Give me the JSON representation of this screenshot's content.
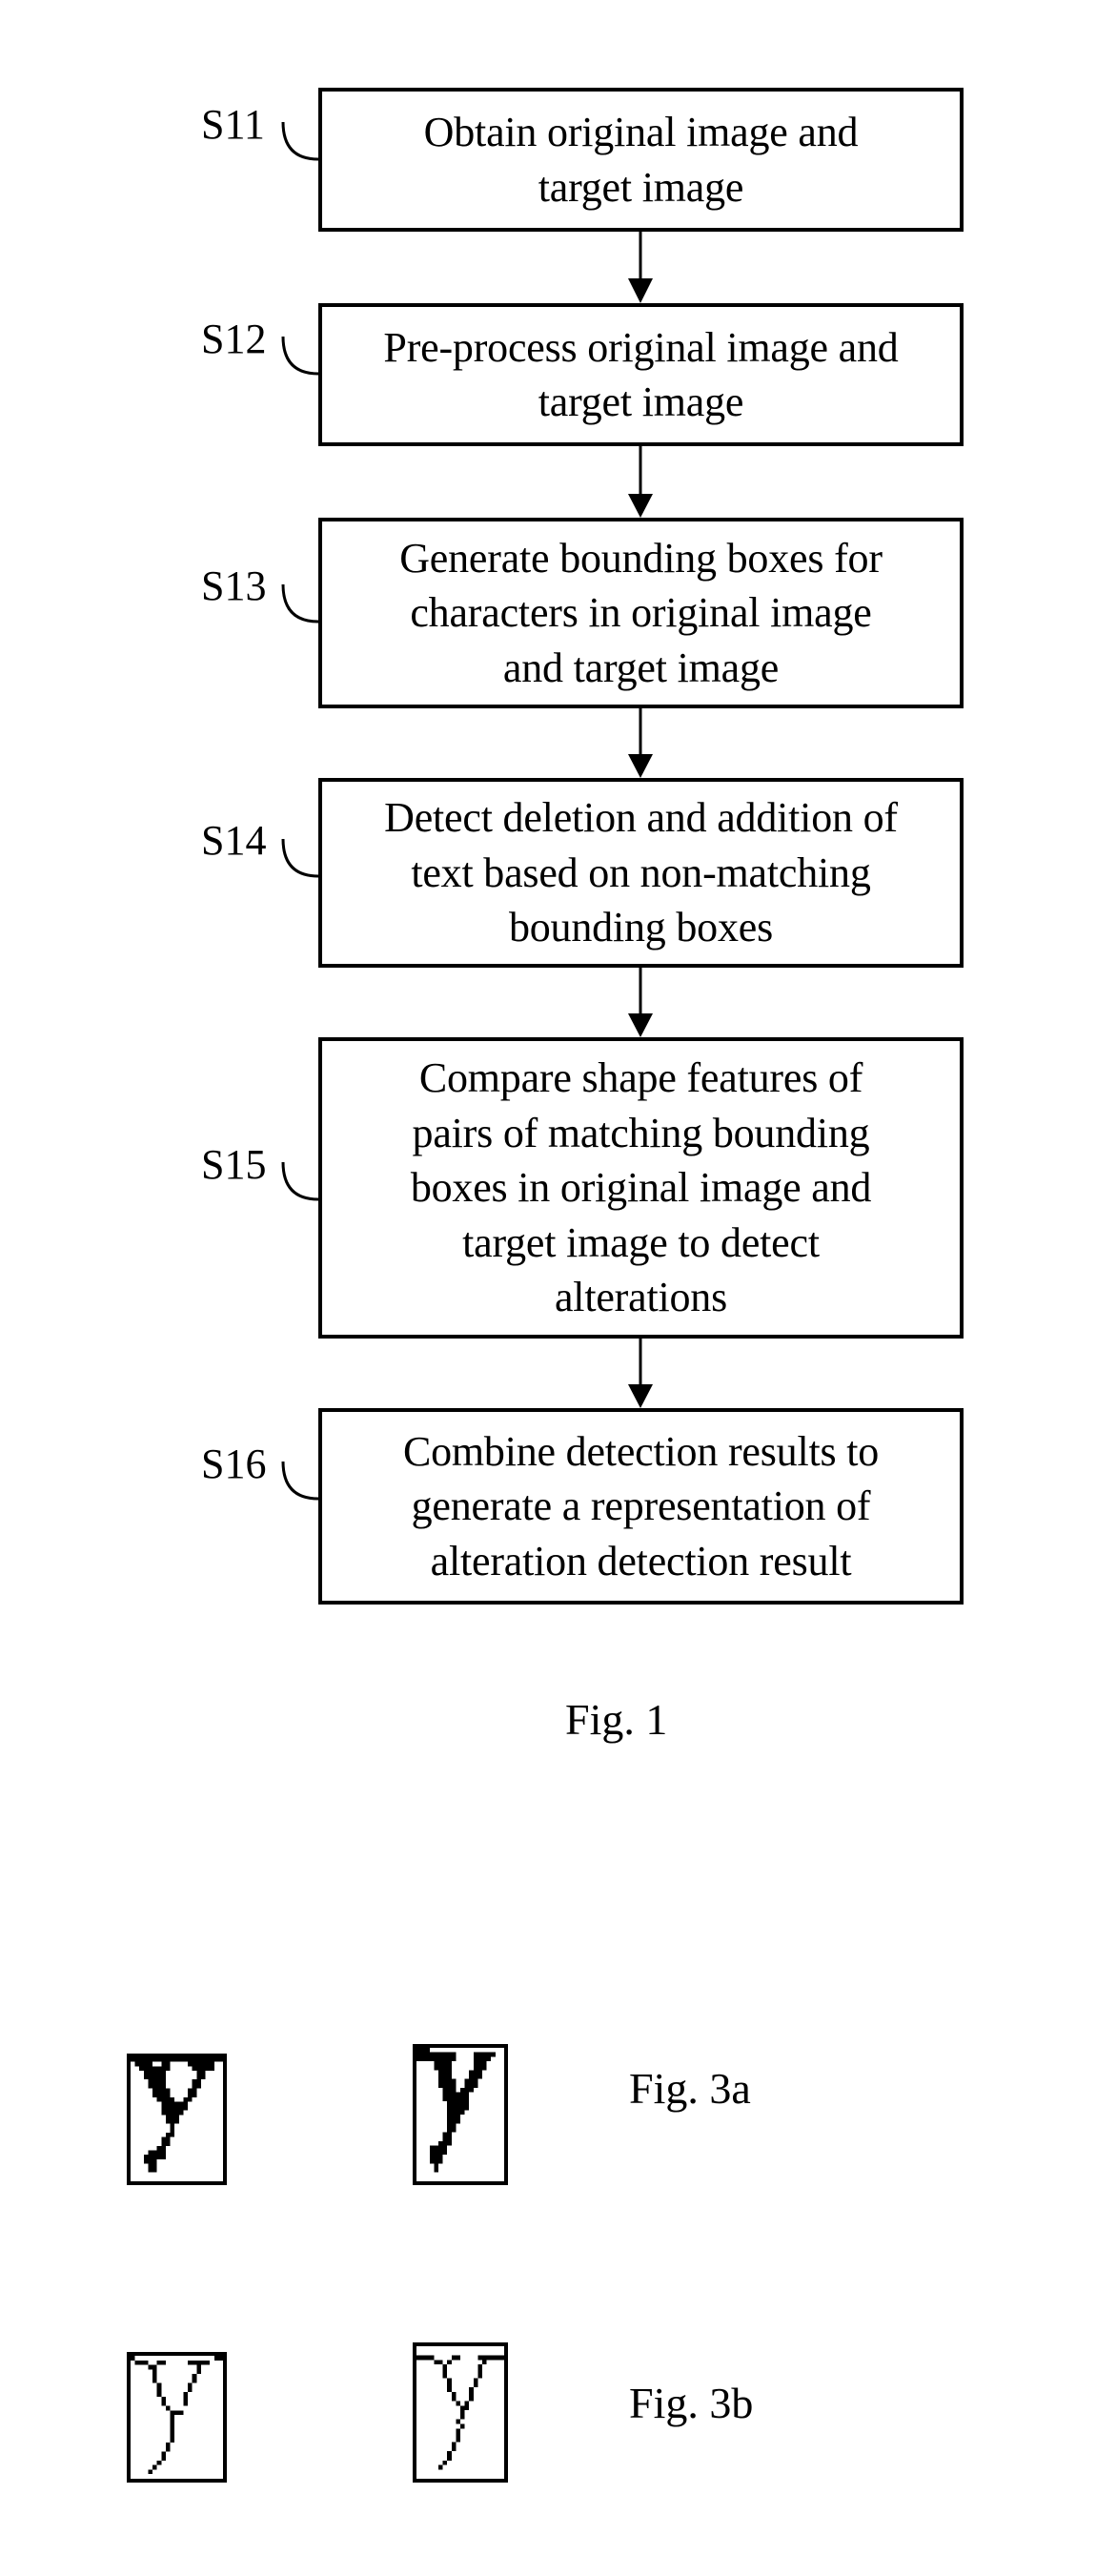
{
  "figure1": {
    "caption": "Fig. 1",
    "steps": [
      {
        "id": "S11",
        "text": "Obtain original image and\ntarget image"
      },
      {
        "id": "S12",
        "text": "Pre-process original image and\ntarget image"
      },
      {
        "id": "S13",
        "text": "Generate bounding boxes for\ncharacters in original image\nand target image"
      },
      {
        "id": "S14",
        "text": "Detect deletion and addition of\ntext based on non-matching\nbounding boxes"
      },
      {
        "id": "S15",
        "text": "Compare shape features of\npairs of matching bounding\nboxes in original image and\ntarget image to detect\nalterations"
      },
      {
        "id": "S16",
        "text": "Combine detection results to\ngenerate a representation of\nalteration detection result"
      }
    ]
  },
  "figure3a": {
    "caption": "Fig. 3a",
    "description": "Pair of bounding boxes containing bitmap of character 'y' (original and target)"
  },
  "figure3b": {
    "caption": "Fig. 3b",
    "description": "Pair of bounding boxes containing skeleton of character 'y' (original and target)"
  }
}
